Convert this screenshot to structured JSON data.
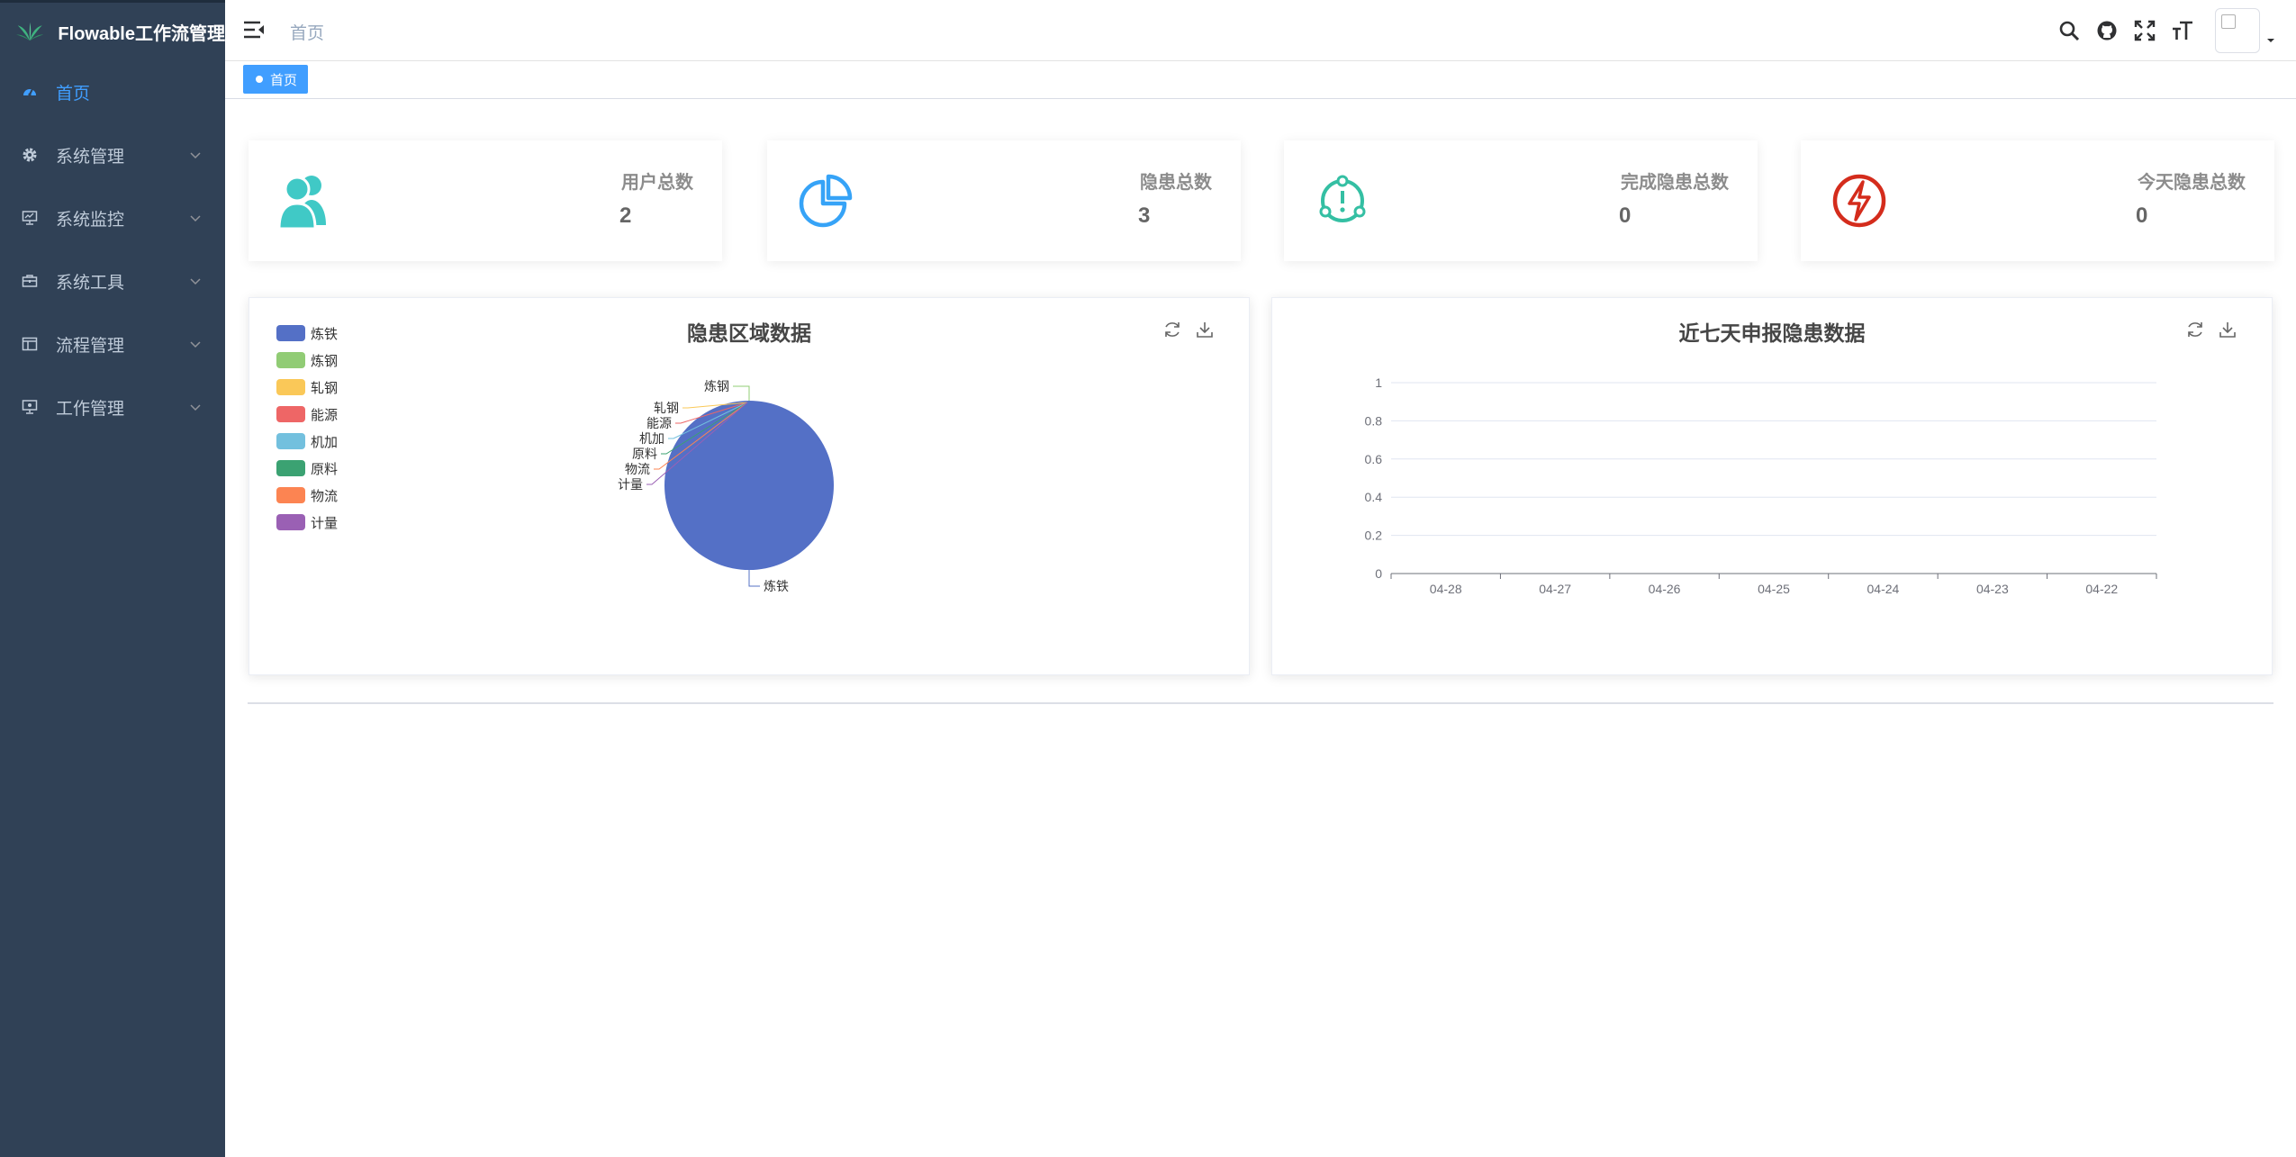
{
  "app": {
    "title": "Flowable工作流管理"
  },
  "sidebar": {
    "items": [
      {
        "label": "首页",
        "icon": "dashboard-icon",
        "active": true
      },
      {
        "label": "系统管理",
        "icon": "gear-icon"
      },
      {
        "label": "系统监控",
        "icon": "monitor-icon"
      },
      {
        "label": "系统工具",
        "icon": "toolbox-icon"
      },
      {
        "label": "流程管理",
        "icon": "table-icon"
      },
      {
        "label": "工作管理",
        "icon": "screen-icon"
      }
    ]
  },
  "header": {
    "breadcrumb": "首页",
    "icons": [
      "search-icon",
      "github-icon",
      "fullscreen-icon",
      "font-size-icon"
    ]
  },
  "tags": {
    "active": "首页"
  },
  "stats": [
    {
      "title": "用户总数",
      "value": "2",
      "icon": "users-icon",
      "color": "#40c9c6"
    },
    {
      "title": "隐患总数",
      "value": "3",
      "icon": "pie-chart-icon",
      "color": "#36a3f7"
    },
    {
      "title": "完成隐患总数",
      "value": "0",
      "icon": "alert-circle-icon",
      "color": "#34bfa3"
    },
    {
      "title": "今天隐患总数",
      "value": "0",
      "icon": "lightning-icon",
      "color": "#d42c1c"
    }
  ],
  "chart_data": [
    {
      "type": "pie",
      "title": "隐患区域数据",
      "legend_placement": "top-left",
      "categories": [
        "炼铁",
        "炼钢",
        "轧钢",
        "能源",
        "机加",
        "原料",
        "物流",
        "计量"
      ],
      "values": [
        3,
        0,
        0,
        0,
        0,
        0,
        0,
        0
      ],
      "colors": [
        "#5470c6",
        "#91cc75",
        "#fac858",
        "#ee6666",
        "#73c0de",
        "#3ba272",
        "#fc8452",
        "#9a60b4"
      ]
    },
    {
      "type": "line",
      "title": "近七天申报隐患数据",
      "x": [
        "04-28",
        "04-27",
        "04-26",
        "04-25",
        "04-24",
        "04-23",
        "04-22"
      ],
      "series": [
        {
          "values": [
            0,
            0,
            0,
            0,
            0,
            0,
            0
          ]
        }
      ],
      "ylim": [
        0,
        1
      ],
      "yticks": [
        "0",
        "0.2",
        "0.4",
        "0.6",
        "0.8",
        "1"
      ],
      "grid": true
    }
  ]
}
